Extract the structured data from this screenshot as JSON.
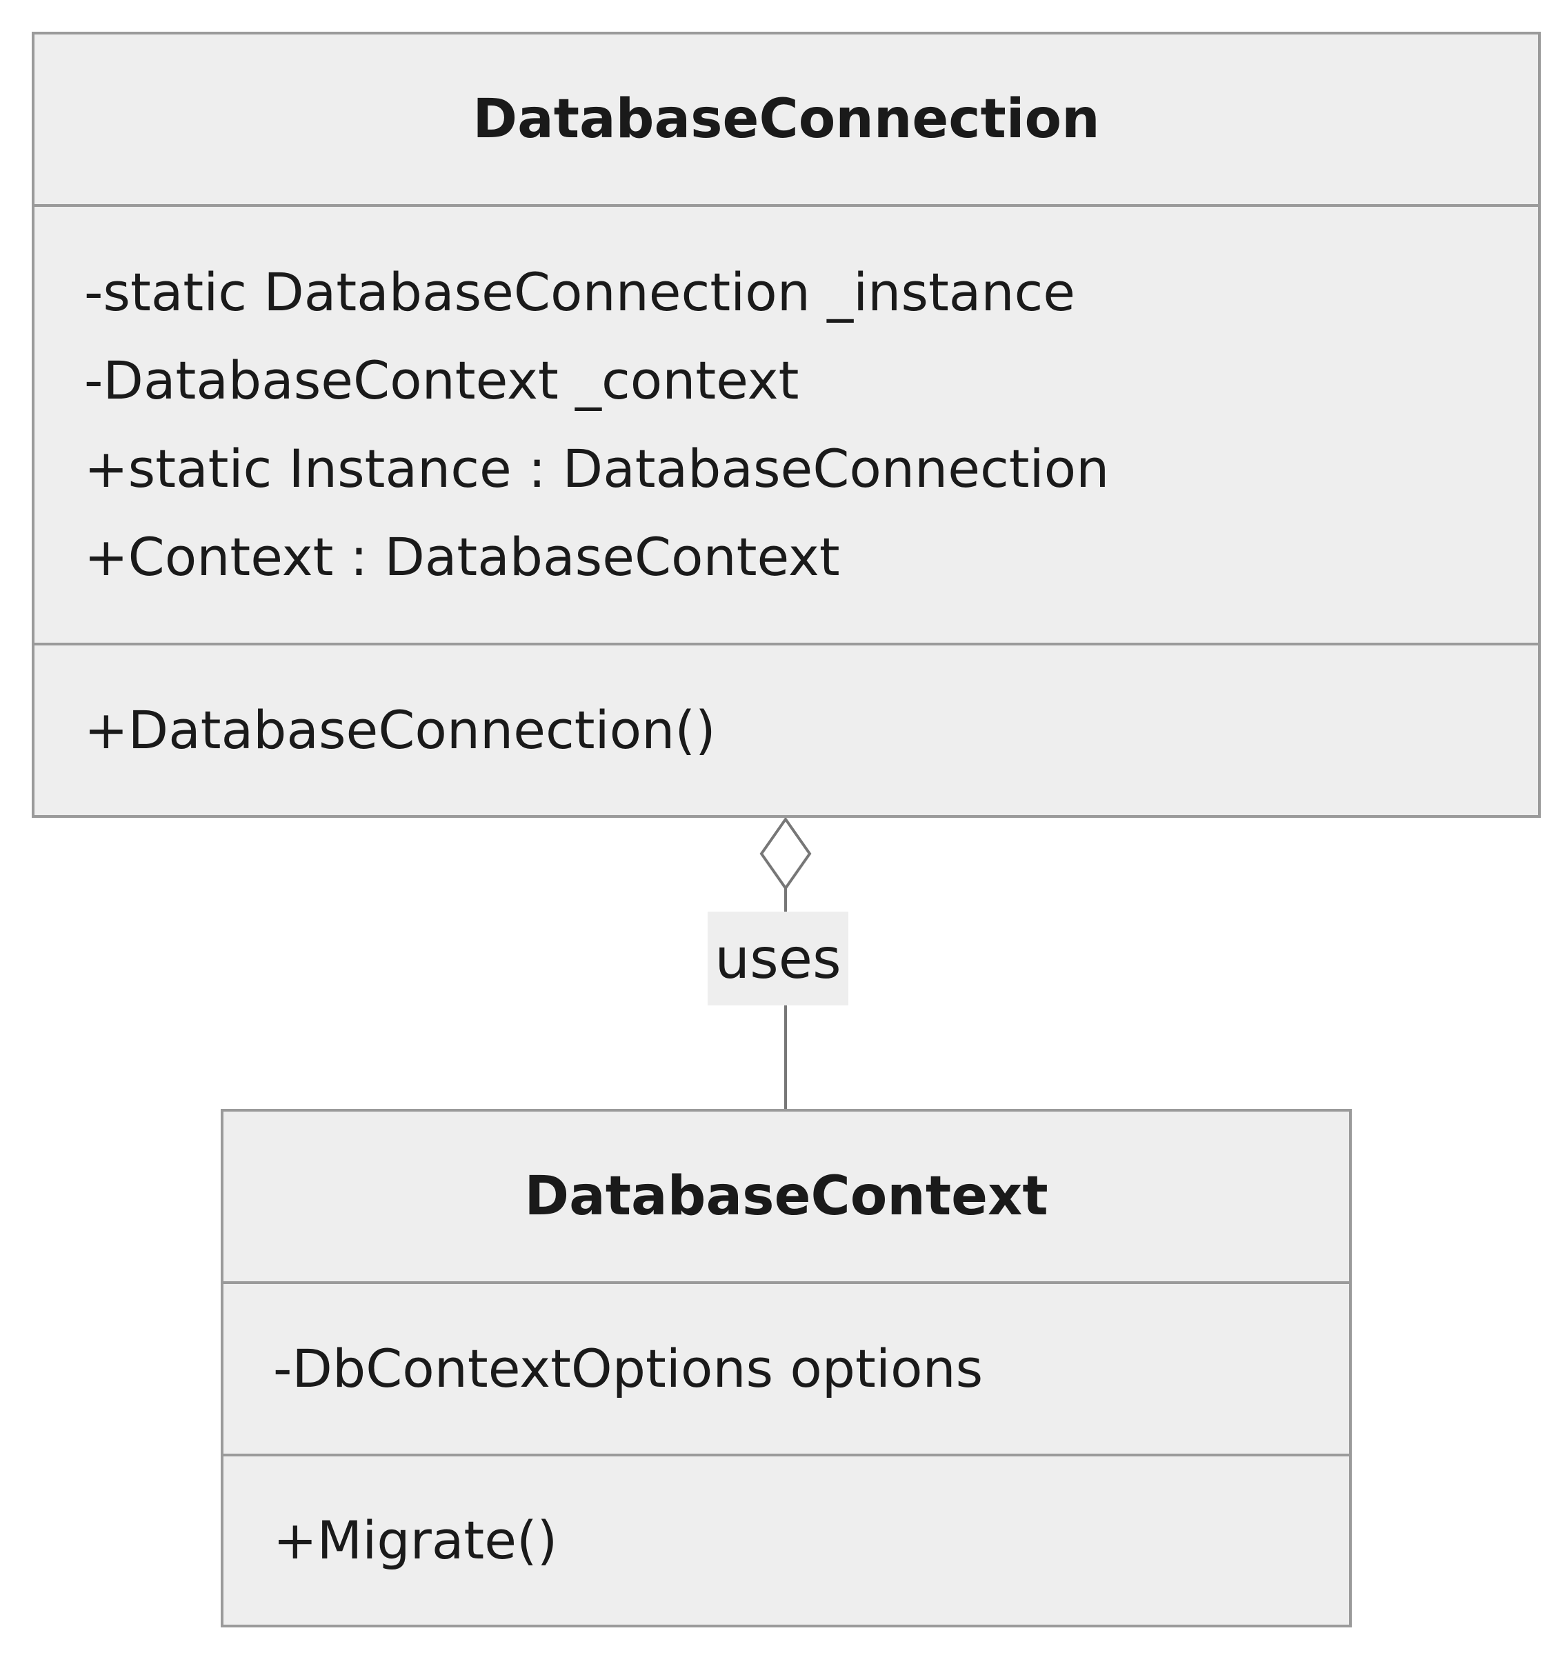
{
  "classes": {
    "connection": {
      "name": "DatabaseConnection",
      "attributes": [
        "-static DatabaseConnection _instance",
        "-DatabaseContext _context",
        "+static Instance : DatabaseConnection",
        "+Context : DatabaseContext"
      ],
      "methods": [
        "+DatabaseConnection()"
      ]
    },
    "context": {
      "name": "DatabaseContext",
      "attributes": [
        "-DbContextOptions options"
      ],
      "methods": [
        "+Migrate()"
      ]
    }
  },
  "relationship": {
    "type": "aggregation",
    "label": "uses"
  },
  "colors": {
    "box_fill": "#eeeeee",
    "box_border": "#9a9a9a",
    "line": "#777777",
    "text": "#1a1a1a"
  }
}
